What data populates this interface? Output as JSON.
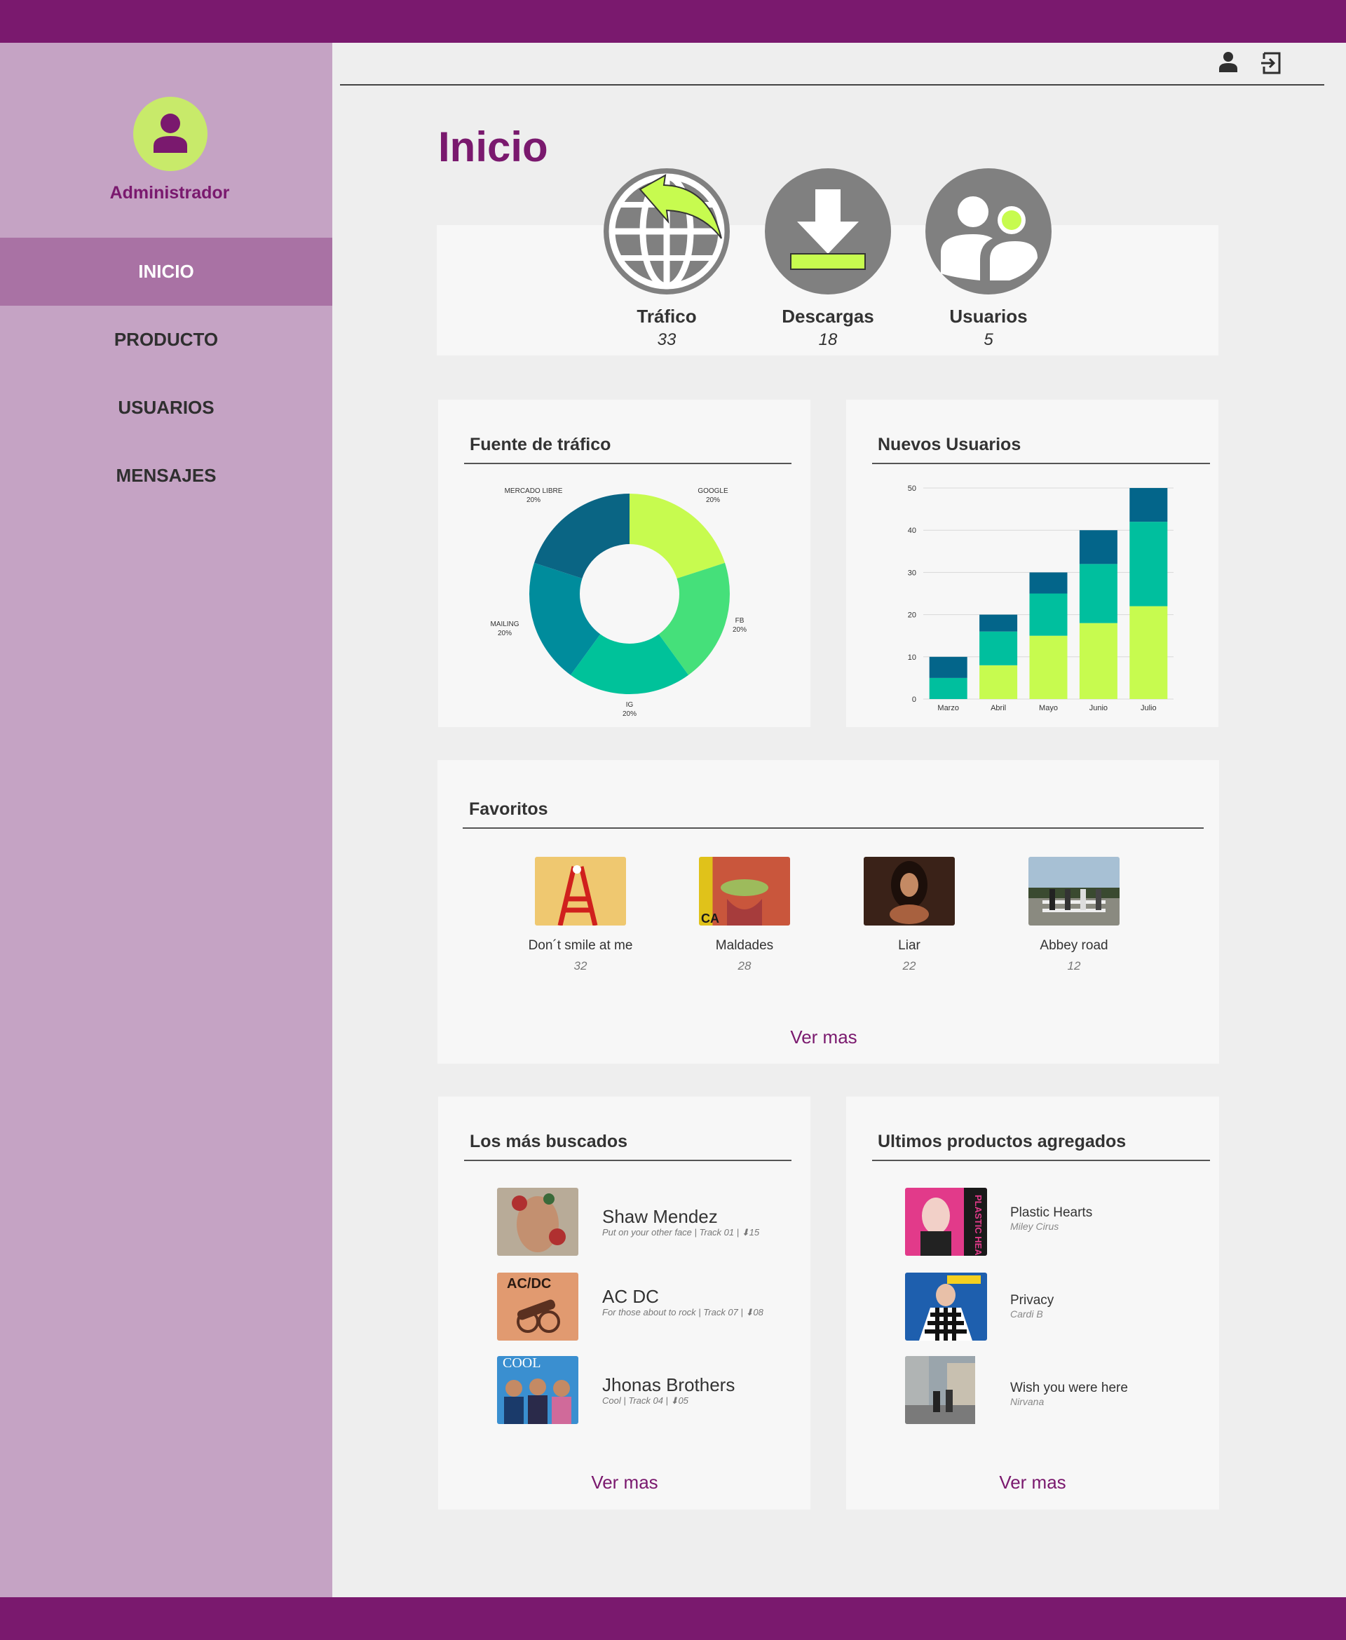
{
  "colors": {
    "brand": "#7a196e",
    "accent": "#c8ea6a",
    "sidebar": "#c5a3c4",
    "sidebar_active": "#a972a4"
  },
  "user": {
    "role": "Administrador"
  },
  "nav": [
    {
      "label": "INICIO",
      "active": true
    },
    {
      "label": "PRODUCTO",
      "active": false
    },
    {
      "label": "USUARIOS",
      "active": false
    },
    {
      "label": "MENSAJES",
      "active": false
    }
  ],
  "header": {
    "icons": [
      "user-icon",
      "logout-icon"
    ]
  },
  "page": {
    "title": "Inicio"
  },
  "stats": [
    {
      "label": "Tráfico",
      "value": "33",
      "icon": "globe-share-icon"
    },
    {
      "label": "Descargas",
      "value": "18",
      "icon": "download-icon"
    },
    {
      "label": "Usuarios",
      "value": "5",
      "icon": "users-icon"
    }
  ],
  "traffic": {
    "title": "Fuente de tráfico"
  },
  "new_users": {
    "title": "Nuevos Usuarios"
  },
  "chart_data": [
    {
      "type": "pie",
      "title": "Fuente de tráfico",
      "donut": true,
      "slices": [
        {
          "label": "GOOGLE",
          "value": 20,
          "pct": "20%",
          "color": "#c7fb4f"
        },
        {
          "label": "FB",
          "value": 20,
          "pct": "20%",
          "color": "#45e07a"
        },
        {
          "label": "IG",
          "value": 20,
          "pct": "20%",
          "color": "#00c29a"
        },
        {
          "label": "MAILING",
          "value": 20,
          "pct": "20%",
          "color": "#008c9c"
        },
        {
          "label": "MERCADO LIBRE",
          "value": 20,
          "pct": "20%",
          "color": "#0a6584"
        }
      ]
    },
    {
      "type": "bar",
      "stacked": true,
      "title": "Nuevos Usuarios",
      "categories": [
        "Marzo",
        "Abril",
        "Mayo",
        "Junio",
        "Julio"
      ],
      "series": [
        {
          "values": [
            0,
            8,
            15,
            18,
            22
          ],
          "color": "#c7fb4f"
        },
        {
          "values": [
            5,
            8,
            10,
            14,
            20
          ],
          "color": "#00bf9e"
        },
        {
          "values": [
            5,
            4,
            5,
            8,
            8
          ],
          "color": "#03658a"
        }
      ],
      "ylim": [
        0,
        50
      ],
      "yticks": [
        0,
        10,
        20,
        30,
        40,
        50
      ],
      "grid": true
    }
  ],
  "favorites": {
    "title": "Favoritos",
    "items": [
      {
        "title": "Don´t smile at me",
        "count": "32"
      },
      {
        "title": "Maldades",
        "count": "28"
      },
      {
        "title": "Liar",
        "count": "22"
      },
      {
        "title": "Abbey road",
        "count": "12"
      }
    ],
    "more": "Ver mas"
  },
  "most_searched": {
    "title": "Los más buscados",
    "items": [
      {
        "artist": "Shaw Mendez",
        "detail": "Put on your other face | Track 01 | ",
        "downloads": "15"
      },
      {
        "artist": "AC DC",
        "detail": "For those about to rock | Track 07 | ",
        "downloads": "08"
      },
      {
        "artist": "Jhonas Brothers",
        "detail": "Cool | Track 04 | ",
        "downloads": "05"
      }
    ],
    "more": "Ver mas"
  },
  "latest": {
    "title": "Ultimos productos agregados",
    "items": [
      {
        "title": "Plastic Hearts",
        "artist": "Miley Cirus"
      },
      {
        "title": "Privacy",
        "artist": "Cardi B"
      },
      {
        "title": "Wish you were here",
        "artist": "Nirvana"
      }
    ],
    "more": "Ver mas"
  }
}
